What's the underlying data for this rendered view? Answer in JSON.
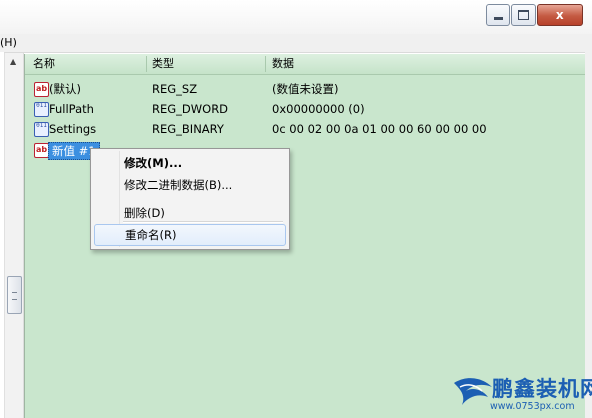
{
  "window": {
    "controls": {
      "minimize_icon": "minimize-icon",
      "maximize_icon": "maximize-icon",
      "close_symbol": "x"
    }
  },
  "menubar": {
    "visible_fragment": "(H)"
  },
  "list": {
    "columns": [
      "名称",
      "类型",
      "数据"
    ],
    "rows": [
      {
        "icon": "string-value-icon",
        "icon_text": "ab",
        "name": "(默认)",
        "type": "REG_SZ",
        "data": "(数值未设置)"
      },
      {
        "icon": "binary-value-icon",
        "icon_text": "011",
        "name": "FullPath",
        "type": "REG_DWORD",
        "data": "0x00000000 (0)"
      },
      {
        "icon": "binary-value-icon",
        "icon_text": "011",
        "name": "Settings",
        "type": "REG_BINARY",
        "data": "0c 00 02 00 0a 01 00 00 60 00 00 00"
      },
      {
        "icon": "string-value-icon",
        "icon_text": "ab",
        "name": "新值 #1",
        "type": "REG_SZ",
        "data": ""
      }
    ]
  },
  "context_menu": {
    "items": [
      {
        "label": "修改(M)..."
      },
      {
        "label": "修改二进制数据(B)..."
      },
      {
        "label": "删除(D)"
      },
      {
        "label": "重命名(R)"
      }
    ]
  },
  "watermark": {
    "brand": "鹏鑫装机网",
    "url": "www.0753px.com"
  },
  "colors": {
    "list_background": "#c9e6cd",
    "selection": "#3c8fe0",
    "brand": "#1c5fb3",
    "close_button": "#c45a42"
  }
}
